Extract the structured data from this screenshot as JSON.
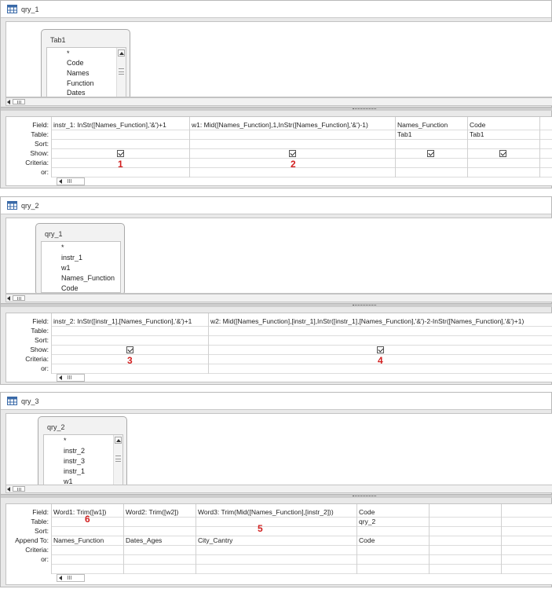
{
  "queries": [
    {
      "title": "qry_1",
      "table": {
        "name": "Tab1",
        "fields": [
          "*",
          "Code",
          "Names",
          "Function",
          "Dates"
        ],
        "has_scrollbar": true
      },
      "row_labels": [
        "Field:",
        "Table:",
        "Sort:",
        "Show:",
        "Criteria:",
        "or:"
      ],
      "columns": [
        {
          "field": "instr_1: InStr([Names_Function],'&')+1",
          "table": "",
          "row3": "",
          "show": true,
          "annotation": "1"
        },
        {
          "field": "w1: Mid([Names_Function],1,InStr([Names_Function],'&')-1)",
          "table": "",
          "row3": "",
          "show": true,
          "annotation": "2"
        },
        {
          "field": "Names_Function",
          "table": "Tab1",
          "row3": "",
          "show": true,
          "annotation": ""
        },
        {
          "field": "Code",
          "table": "Tab1",
          "row3": "",
          "show": true,
          "annotation": ""
        }
      ]
    },
    {
      "title": "qry_2",
      "table": {
        "name": "qry_1",
        "fields": [
          "*",
          "instr_1",
          "w1",
          "Names_Function",
          "Code"
        ],
        "has_scrollbar": false
      },
      "row_labels": [
        "Field:",
        "Table:",
        "Sort:",
        "Show:",
        "Criteria:",
        "or:"
      ],
      "columns": [
        {
          "field": "instr_2: InStr([instr_1],[Names_Function],'&')+1",
          "table": "",
          "row3": "",
          "show": true,
          "annotation": "3"
        },
        {
          "field": "w2: Mid([Names_Function],[instr_1],InStr([instr_1],[Names_Function],'&')-2-InStr([Names_Function],'&')+1)",
          "table": "",
          "row3": "",
          "show": true,
          "annotation": "4"
        }
      ]
    },
    {
      "title": "qry_3",
      "table": {
        "name": "qry_2",
        "fields": [
          "*",
          "instr_2",
          "instr_3",
          "instr_1",
          "w1"
        ],
        "has_scrollbar": true
      },
      "row_labels": [
        "Field:",
        "Table:",
        "Sort:",
        "Append To:",
        "Criteria:",
        "or:"
      ],
      "columns": [
        {
          "field": "Word1: Trim([w1])",
          "table": "",
          "row3": "Names_Function",
          "show": false,
          "annotation": "6"
        },
        {
          "field": "Word2: Trim([w2])",
          "table": "",
          "row3": "Dates_Ages",
          "show": false,
          "annotation": ""
        },
        {
          "field": "Word3: Trim(Mid([Names_Function],[instr_2]))",
          "table": "",
          "row3": "City_Cantry",
          "show": false,
          "annotation": "5"
        },
        {
          "field": "Code",
          "table": "qry_2",
          "row3": "Code",
          "show": false,
          "annotation": ""
        }
      ]
    }
  ],
  "colors": {
    "annotation": "#d21f1f",
    "panel_bg": "#e9e9e9",
    "grid_bg": "#ffffff"
  },
  "icons": {
    "query": "query-design-icon",
    "checkbox": "checkbox-checked-icon"
  }
}
